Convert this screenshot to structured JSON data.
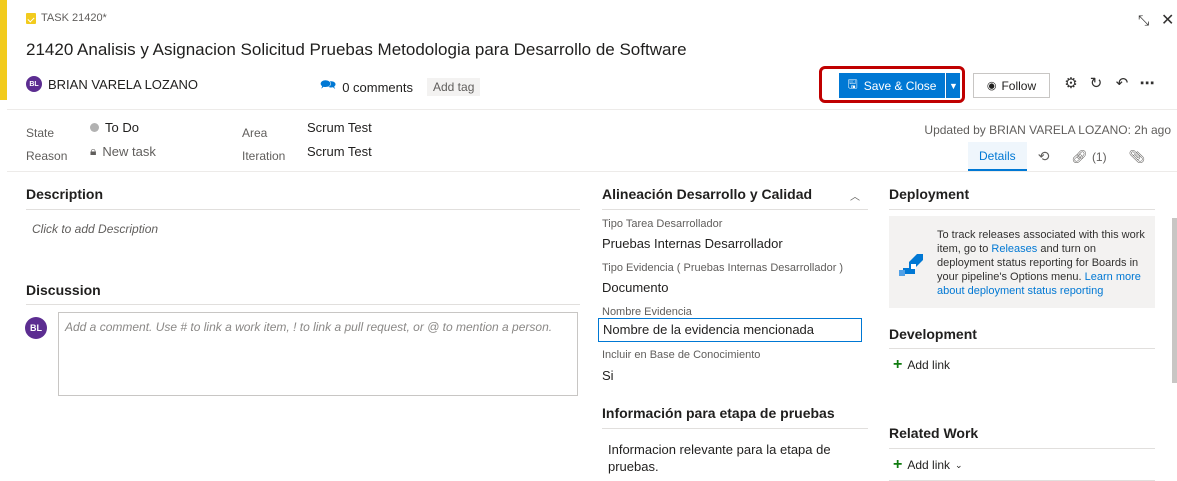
{
  "header": {
    "task_type": "TASK 21420*",
    "title": "21420  Analisis y Asignacion Solicitud Pruebas Metodologia para Desarrollo de Software",
    "owner_initials": "BL",
    "owner_name": "BRIAN VARELA LOZANO",
    "comments": "0 comments",
    "add_tag": "Add tag"
  },
  "toolbar": {
    "save_close": "Save & Close",
    "follow": "Follow"
  },
  "fields": {
    "state_label": "State",
    "state_value": "To Do",
    "reason_label": "Reason",
    "reason_value": "New task",
    "area_label": "Area",
    "area_value": "Scrum Test",
    "iteration_label": "Iteration",
    "iteration_value": "Scrum Test",
    "updated": "Updated by BRIAN VARELA LOZANO: 2h ago"
  },
  "tabs": {
    "details": "Details",
    "links": "(1)"
  },
  "description": {
    "title": "Description",
    "placeholder": "Click to add Description"
  },
  "discussion": {
    "title": "Discussion",
    "avatar_initials": "BL",
    "placeholder": "Add a comment. Use # to link a work item, ! to link a pull request, or @ to mention a person."
  },
  "alineacion": {
    "title": "Alineación Desarrollo y Calidad",
    "tipo_tarea_label": "Tipo Tarea Desarrollador",
    "tipo_tarea_value": "Pruebas Internas Desarrollador",
    "tipo_evidencia_label": "Tipo Evidencia ( Pruebas Internas Desarrollador )",
    "tipo_evidencia_value": "Documento",
    "nombre_evidencia_label": "Nombre Evidencia",
    "nombre_evidencia_value": "Nombre de la evidencia mencionada",
    "incluir_label": "Incluir en Base de Conocimiento",
    "incluir_value": "Si"
  },
  "pruebas": {
    "title": "Información para etapa de pruebas",
    "value": "Informacion relevante para la etapa de pruebas."
  },
  "deployment": {
    "title": "Deployment",
    "text_1": "To track releases associated with this work item, go to ",
    "link_1": "Releases",
    "text_2": " and turn on deployment status reporting for Boards in your pipeline's Options menu. ",
    "link_2": "Learn more about deployment status reporting"
  },
  "development": {
    "title": "Development",
    "add_link": "Add link"
  },
  "related": {
    "title": "Related Work",
    "add_link": "Add link"
  },
  "colors": {
    "accent": "#f2cb1d",
    "primary": "#0078d4",
    "highlight": "#c00000",
    "avatar": "#5c2d91",
    "add": "#107c10"
  },
  "icons": [
    "task-icon",
    "comment-icon",
    "save-icon",
    "chevron-down-icon",
    "eye-icon",
    "gear-icon",
    "refresh-icon",
    "undo-icon",
    "more-icon",
    "collapse-icon",
    "close-icon",
    "history-icon",
    "link-icon",
    "attachment-icon",
    "lock-icon",
    "chevron-up-icon",
    "pipeline-icon",
    "plus-icon"
  ]
}
